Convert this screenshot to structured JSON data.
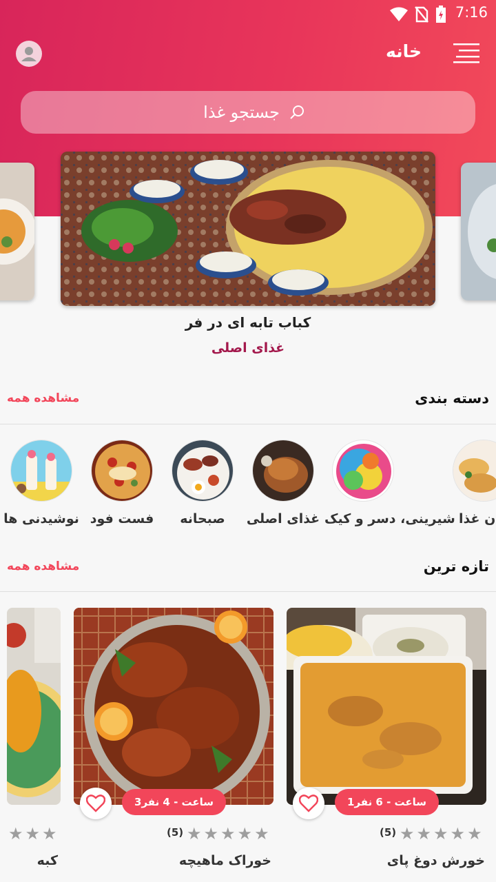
{
  "status": {
    "time": "7:16"
  },
  "header": {
    "title": "خانه"
  },
  "search": {
    "placeholder": "جستجو غذا"
  },
  "featured": {
    "title": "کباب تابه ای در فر",
    "category": "غذای اصلی"
  },
  "categories_section": {
    "title": "دسته بندی",
    "see_all": "مشاهده همه"
  },
  "categories": [
    {
      "label": "ن غذا"
    },
    {
      "label": "شیرینی، دسر و کیک"
    },
    {
      "label": "غذای اصلی"
    },
    {
      "label": "صبحانه"
    },
    {
      "label": "فست فود"
    },
    {
      "label": "نوشیدنی ها"
    }
  ],
  "newest_section": {
    "title": "تازه ترین",
    "see_all": "مشاهده همه"
  },
  "recipes": [
    {
      "title": "خورش دوغ پای",
      "badge": "1ساعت - 6 نفر",
      "rating_count": "(5)"
    },
    {
      "title": "خوراک ماهیچه",
      "badge": "3ساعت - 4 نفر",
      "rating_count": "(5)"
    },
    {
      "title": "کبه"
    }
  ],
  "colors": {
    "accent": "#f2465a",
    "category": "#a3184c",
    "star": "#9e9e9e"
  }
}
